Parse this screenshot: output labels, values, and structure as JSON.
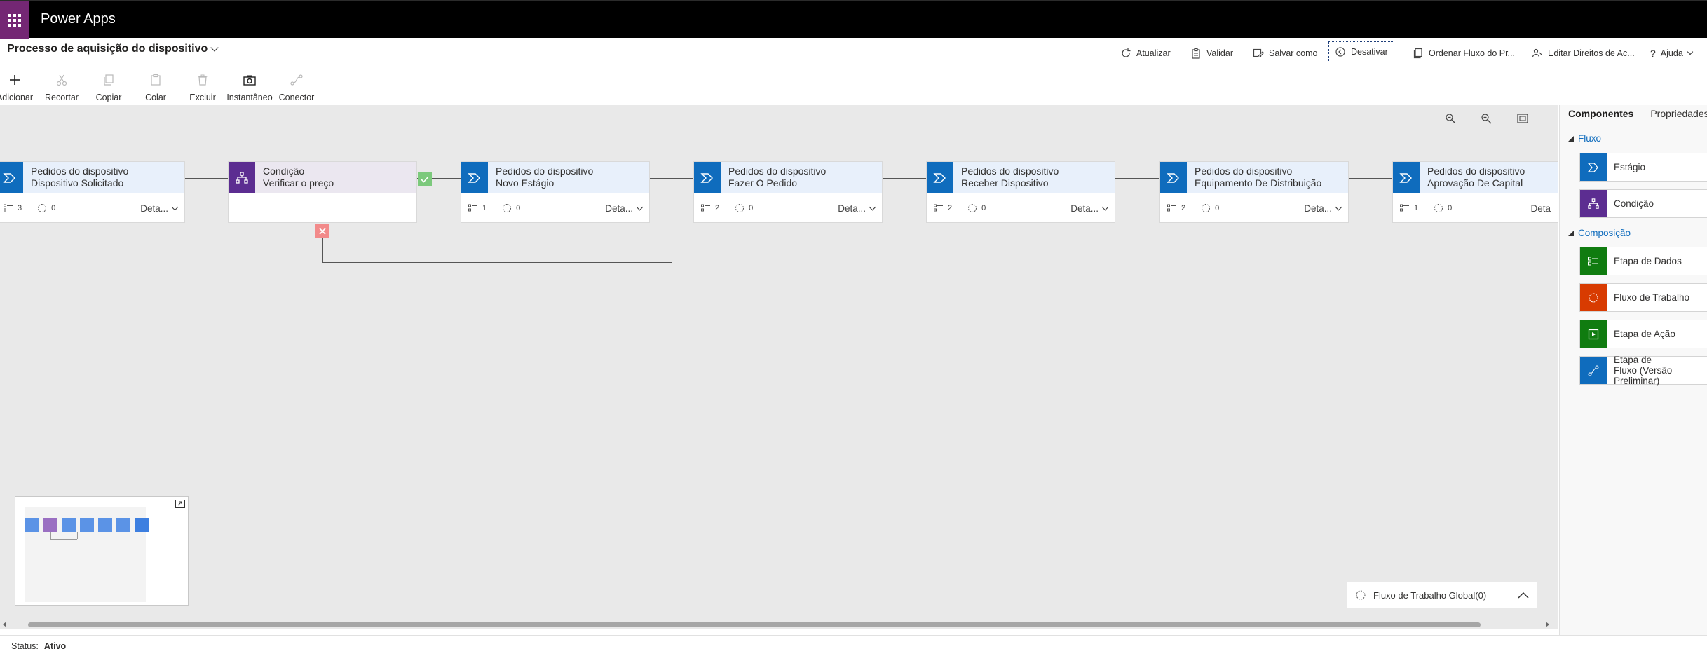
{
  "app": {
    "title": "Power Apps"
  },
  "header": {
    "process_title": "Processo de aquisição do dispositivo"
  },
  "commands": {
    "refresh": "Atualizar",
    "validate": "Validar",
    "save_as": "Salvar como",
    "deactivate": "Desativar",
    "order_flow": "Ordenar Fluxo do Pr...",
    "edit_rights": "Editar Direitos de Ac...",
    "help": "Ajuda"
  },
  "ribbon": {
    "add": "Adicionar",
    "cut": "Recortar",
    "copy": "Copiar",
    "paste": "Colar",
    "delete": "Excluir",
    "snapshot": "Instantâneo",
    "connector": "Conector"
  },
  "canvas": {
    "nodes": [
      {
        "line1": "Pedidos do dispositivo",
        "line2": "Dispositivo Solicitado",
        "steps": "3",
        "workflows": "0",
        "details": "Deta..."
      },
      {
        "line1": "Condição",
        "line2": "Verificar o preço"
      },
      {
        "line1": "Pedidos do dispositivo",
        "line2": "Novo Estágio",
        "steps": "1",
        "workflows": "0",
        "details": "Deta..."
      },
      {
        "line1": "Pedidos do dispositivo",
        "line2": "Fazer O Pedido",
        "steps": "2",
        "workflows": "0",
        "details": "Deta..."
      },
      {
        "line1": "Pedidos do dispositivo",
        "line2": "Receber Dispositivo",
        "steps": "2",
        "workflows": "0",
        "details": "Deta..."
      },
      {
        "line1": "Pedidos do dispositivo",
        "line2": "Equipamento De Distribuição",
        "steps": "2",
        "workflows": "0",
        "details": "Deta..."
      },
      {
        "line1": "Pedidos do dispositivo",
        "line2": "Aprovação De Capital",
        "steps": "1",
        "workflows": "0",
        "details": "Deta"
      }
    ],
    "global_workflow": "Fluxo de Trabalho Global(0)"
  },
  "panel": {
    "tabs": [
      "Componentes",
      "Propriedades"
    ],
    "flow_section": "Fluxo",
    "flow_items": [
      "Estágio",
      "Condição"
    ],
    "composition_section": "Composição",
    "composition_items": [
      "Etapa de Dados",
      "Fluxo de Trabalho",
      "Etapa de Ação",
      "Etapa de Fluxo (Versão Preliminar)"
    ]
  },
  "colors": {
    "stage": "#0f6cbd",
    "condition": "#5c2d91",
    "data_step": "#107c10",
    "workflow": "#d83b01",
    "action_step": "#107c10",
    "flow_step": "#0f6cbd"
  },
  "status": {
    "label": "Status:",
    "value": "Ativo"
  }
}
